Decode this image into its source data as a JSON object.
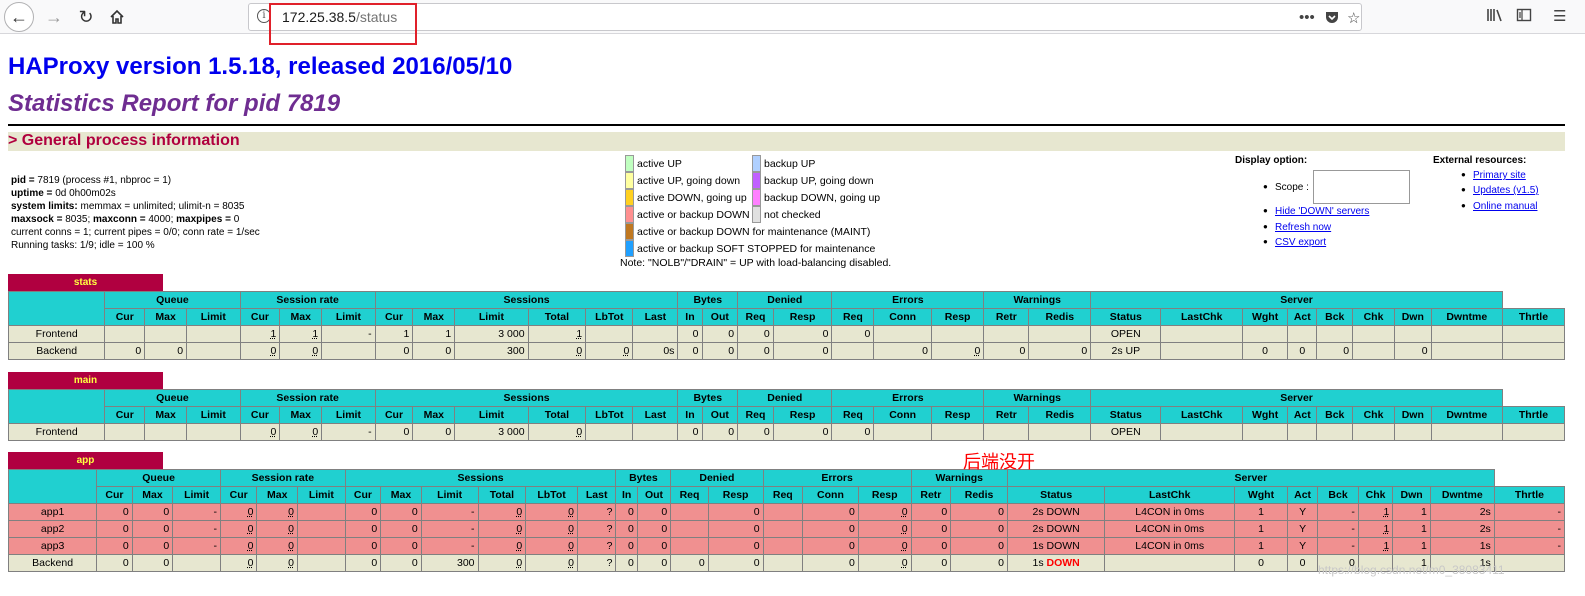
{
  "browser": {
    "url_host": "172.25.38.5",
    "url_path": "/status",
    "back_icon": "arrow-left",
    "forward_icon": "arrow-right",
    "reload_icon": "reload",
    "home_icon": "home"
  },
  "page": {
    "title": "HAProxy version 1.5.18, released 2016/05/10",
    "subtitle": "Statistics Report for pid 7819",
    "section": "> General process information"
  },
  "process": {
    "l1_b": "pid = ",
    "l1": "7819 (process #1, nbproc = 1)",
    "l2_b": "uptime = ",
    "l2": "0d 0h00m02s",
    "l3_b": "system limits: ",
    "l3": "memmax = unlimited; ulimit-n = 8035",
    "l4_b1": "maxsock = ",
    "l4_v1": "8035; ",
    "l4_b2": "maxconn = ",
    "l4_v2": "4000; ",
    "l4_b3": "maxpipes = ",
    "l4_v3": "0",
    "l5": "current conns = 1; current pipes = 0/0; conn rate = 1/sec",
    "l6": "Running tasks: 1/9; idle = 100 %"
  },
  "legend": {
    "left": [
      "active UP",
      "active UP, going down",
      "active DOWN, going up",
      "active or backup DOWN",
      "active or backup DOWN for maintenance (MAINT)",
      "active or backup SOFT STOPPED for maintenance"
    ],
    "right": [
      "backup UP",
      "backup UP, going down",
      "backup DOWN, going up",
      "not checked"
    ],
    "left_colors": [
      "#c0ffc0",
      "#ffffa0",
      "#ffd020",
      "#ff9090",
      "#c07820",
      "#20a0ff"
    ],
    "right_colors": [
      "#b0d0ff",
      "#c060ff",
      "#ff80ff",
      "#e0e0e0"
    ],
    "note": "Note: \"NOLB\"/\"DRAIN\" = UP with load-balancing disabled."
  },
  "display_option": {
    "title": "Display option:",
    "scope_label": "Scope :",
    "hide_down": "Hide 'DOWN' servers",
    "refresh": "Refresh now",
    "csv": "CSV export"
  },
  "external": {
    "title": "External resources:",
    "primary": "Primary site",
    "updates": "Updates (v1.5)",
    "manual": "Online manual"
  },
  "headers": {
    "queue": "Queue",
    "session_rate": "Session rate",
    "sessions": "Sessions",
    "bytes": "Bytes",
    "denied": "Denied",
    "errors": "Errors",
    "warnings": "Warnings",
    "server": "Server",
    "cur": "Cur",
    "max": "Max",
    "limit": "Limit",
    "total": "Total",
    "lbtot": "LbTot",
    "last": "Last",
    "in": "In",
    "out": "Out",
    "req": "Req",
    "resp": "Resp",
    "conn": "Conn",
    "retr": "Retr",
    "redis": "Redis",
    "status": "Status",
    "lastchk": "LastChk",
    "wght": "Wght",
    "act": "Act",
    "bck": "Bck",
    "chk": "Chk",
    "dwn": "Dwn",
    "dwntme": "Dwntme",
    "thrtle": "Thrtle"
  },
  "proxies": {
    "stats": {
      "name": "stats",
      "frontend": [
        "Frontend",
        "",
        "",
        "",
        "1",
        "1",
        "-",
        "1",
        "1",
        "3 000",
        "1",
        "",
        "",
        "0",
        "0",
        "0",
        "0",
        "0",
        "",
        "",
        "",
        "",
        "OPEN",
        "",
        "",
        "",
        "",
        "",
        "",
        "",
        ""
      ],
      "backend": [
        "Backend",
        "0",
        "0",
        "",
        "0",
        "0",
        "",
        "0",
        "0",
        "300",
        "0",
        "0",
        "0s",
        "0",
        "0",
        "0",
        "0",
        "",
        "0",
        "0",
        "0",
        "0",
        "2s UP",
        "",
        "0",
        "0",
        "0",
        "",
        "0",
        "",
        ""
      ]
    },
    "main": {
      "name": "main",
      "frontend": [
        "Frontend",
        "",
        "",
        "",
        "0",
        "0",
        "-",
        "0",
        "0",
        "3 000",
        "0",
        "",
        "",
        "0",
        "0",
        "0",
        "0",
        "0",
        "",
        "",
        "",
        "",
        "OPEN",
        "",
        "",
        "",
        "",
        "",
        "",
        "",
        ""
      ]
    },
    "app": {
      "name": "app",
      "servers": [
        [
          "app1",
          "0",
          "0",
          "-",
          "0",
          "0",
          "",
          "0",
          "0",
          "-",
          "0",
          "0",
          "?",
          "0",
          "0",
          "",
          "0",
          "",
          "0",
          "0",
          "0",
          "0",
          "2s DOWN",
          "L4CON in 0ms",
          "1",
          "Y",
          "-",
          "1",
          "1",
          "2s",
          "-"
        ],
        [
          "app2",
          "0",
          "0",
          "-",
          "0",
          "0",
          "",
          "0",
          "0",
          "-",
          "0",
          "0",
          "?",
          "0",
          "0",
          "",
          "0",
          "",
          "0",
          "0",
          "0",
          "0",
          "2s DOWN",
          "L4CON in 0ms",
          "1",
          "Y",
          "-",
          "1",
          "1",
          "2s",
          "-"
        ],
        [
          "app3",
          "0",
          "0",
          "-",
          "0",
          "0",
          "",
          "0",
          "0",
          "-",
          "0",
          "0",
          "?",
          "0",
          "0",
          "",
          "0",
          "",
          "0",
          "0",
          "0",
          "0",
          "1s DOWN",
          "L4CON in 0ms",
          "1",
          "Y",
          "-",
          "1",
          "1",
          "1s",
          "-"
        ]
      ],
      "backend": [
        "Backend",
        "0",
        "0",
        "",
        "0",
        "0",
        "",
        "0",
        "0",
        "300",
        "0",
        "0",
        "?",
        "0",
        "0",
        "0",
        "0",
        "",
        "0",
        "0",
        "0",
        "0",
        "1s ",
        "",
        "0",
        "0",
        "0",
        "",
        "1",
        "1s",
        ""
      ],
      "backend_status_red": "DOWN"
    }
  },
  "annotation": "后端没开",
  "watermark": "https://blog.csdn.net/m0_38083411"
}
